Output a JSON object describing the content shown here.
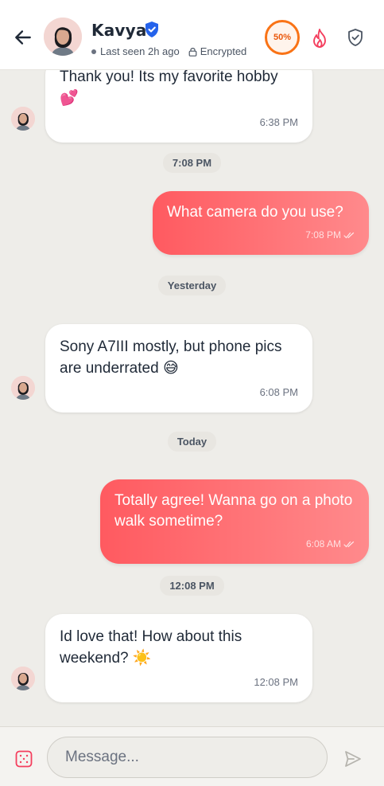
{
  "header": {
    "contact_name": "Kavya",
    "status_text": "Last seen 2h ago",
    "encrypted_label": "Encrypted",
    "progress_label": "50%",
    "progress_value": 0.5,
    "accent_color": "#f97316",
    "brand_color": "#ff5a60"
  },
  "messages": [
    {
      "direction": "in",
      "text": "Thank you! Its my favorite hobby",
      "emoji": "💕",
      "time": "6:38 PM"
    },
    {
      "separator": "7:08 PM"
    },
    {
      "direction": "out",
      "text": "What camera do you use?",
      "time": "7:08 PM"
    },
    {
      "separator": "Yesterday"
    },
    {
      "direction": "in",
      "text": "Sony A7III mostly, but phone pics are underrated",
      "emoji": "😅",
      "time": "6:08 PM"
    },
    {
      "separator": "Today"
    },
    {
      "direction": "out",
      "text": "Totally agree! Wanna go on a photo walk sometime?",
      "time": "6:08 AM"
    },
    {
      "separator": "12:08 PM"
    },
    {
      "direction": "in",
      "text": "Id love that! How about this weekend?",
      "emoji": "☀️",
      "time": "12:08 PM"
    }
  ],
  "composer": {
    "placeholder": "Message..."
  },
  "icons": {
    "back": "arrow-left-icon",
    "verified": "verified-shield-icon",
    "flame": "flame-icon",
    "shield": "shield-check-icon",
    "dice": "dice-icon",
    "send": "send-icon"
  }
}
